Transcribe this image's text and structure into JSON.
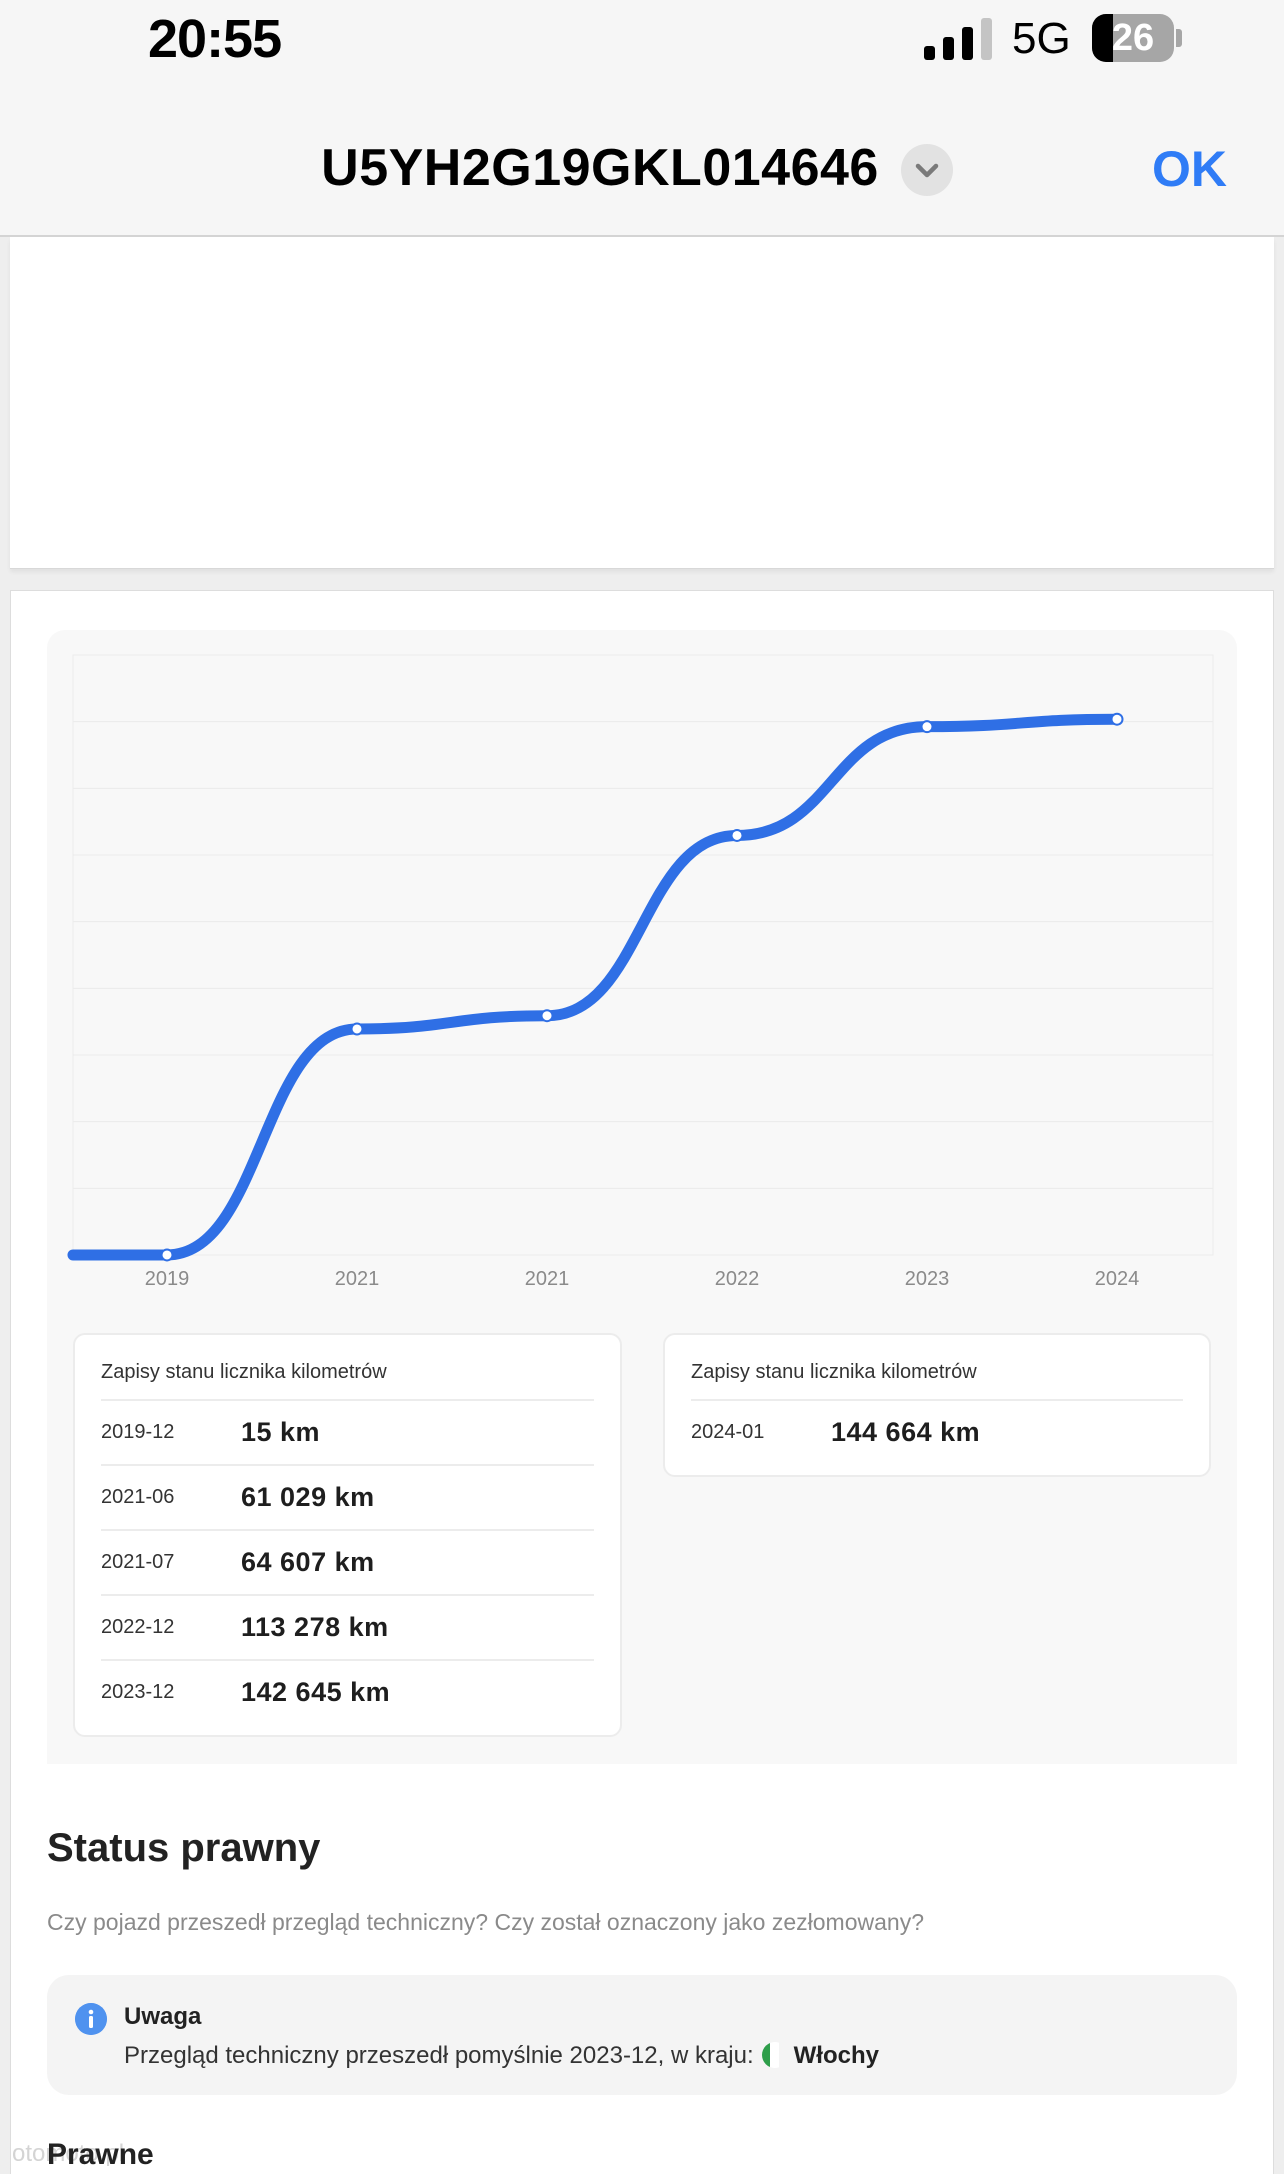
{
  "status_bar": {
    "time": "20:55",
    "network": "5G",
    "battery": 26,
    "signal_bars_active": 3,
    "signal_bars_total": 4
  },
  "nav": {
    "title": "U5YH2G19GKL014646",
    "ok_label": "OK",
    "accent_color": "#2f7cf6",
    "chevron_icon": "chevron-down-icon"
  },
  "chart_data": {
    "type": "line",
    "x": [
      "2019-12",
      "2021-06",
      "2021-07",
      "2022-12",
      "2023-12",
      "2024-01"
    ],
    "tick_labels": [
      "2019",
      "2021",
      "2021",
      "2022",
      "2023",
      "2024"
    ],
    "series": [
      {
        "values": [
          15,
          61029,
          64607,
          113278,
          142645,
          144664
        ],
        "color": "#2f6fe5"
      }
    ],
    "ylim": [
      0,
      162000
    ],
    "y_ticks_visible": false,
    "grid": true,
    "legend": "none"
  },
  "readings": [
    {
      "title": "Zapisy stanu licznika kilometrów",
      "rows": [
        {
          "date": "2019-12",
          "value": "15 km"
        },
        {
          "date": "2021-06",
          "value": "61 029 km"
        },
        {
          "date": "2021-07",
          "value": "64 607 km"
        },
        {
          "date": "2022-12",
          "value": "113 278 km"
        },
        {
          "date": "2023-12",
          "value": "142 645 km"
        }
      ]
    },
    {
      "title": "Zapisy stanu licznika kilometrów",
      "rows": [
        {
          "date": "2024-01",
          "value": "144 664 km"
        }
      ]
    }
  ],
  "legal": {
    "title": "Status prawny",
    "subtitle": "Czy pojazd przeszedł przegląd techniczny? Czy został oznaczony jako zezłomowany?",
    "notice": {
      "icon": "info-icon",
      "title": "Uwaga",
      "text": "Przegląd techniczny przeszedł pomyślnie 2023-12, w kraju:",
      "flag": "italy-flag-icon",
      "country": "Włochy"
    }
  },
  "next_section_title": "Prawne",
  "watermark": "otomoto.pl"
}
